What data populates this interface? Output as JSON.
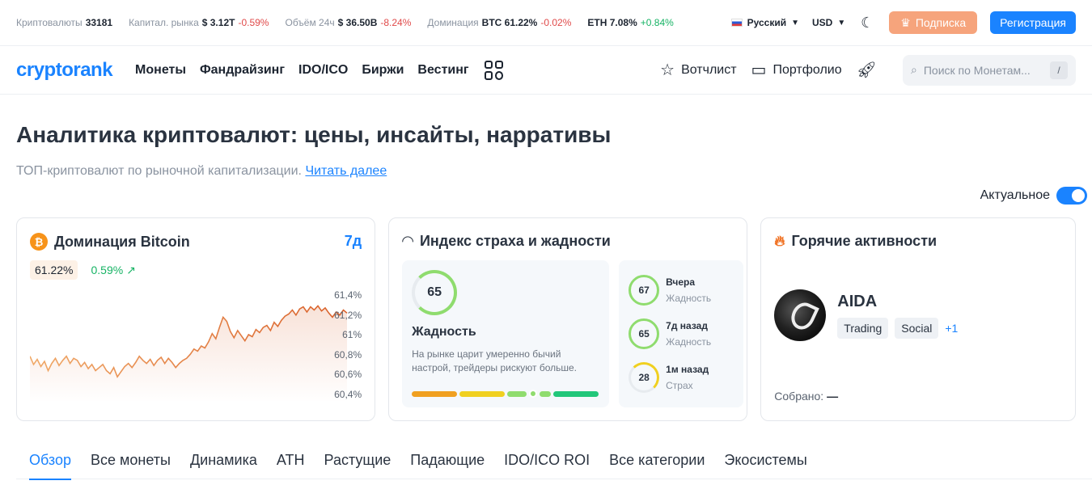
{
  "topbar": {
    "stats": [
      {
        "label": "Криптовалюты",
        "value": "33181",
        "change": ""
      },
      {
        "label": "Капитал. рынка",
        "value": "$ 3.12T",
        "change": "-0.59%"
      },
      {
        "label": "Объём 24ч",
        "value": "$ 36.50B",
        "change": "-8.24%"
      },
      {
        "label": "Доминация",
        "value": "BTC 61.22%",
        "change": "-0.02%"
      }
    ],
    "eth": {
      "value": "ETH 7.08%",
      "change": "+0.84%"
    },
    "language": "Русский",
    "currency": "USD",
    "subscribe_label": "Подписка",
    "register_label": "Регистрация"
  },
  "nav": {
    "logo": "cryptorank",
    "links": [
      "Монеты",
      "Фандрайзинг",
      "IDO/ICO",
      "Биржи",
      "Вестинг"
    ],
    "watchlist": "Вотчлист",
    "portfolio": "Портфолио",
    "search_placeholder": "Поиск по Монетам...",
    "search_shortcut": "/"
  },
  "hero": {
    "title": "Аналитика криптовалют: цены, инсайты, нарративы",
    "subtitle": "ТОП-криптовалют по рыночной капитализации.",
    "read_more": "Читать далее",
    "toggle_label": "Актуальное"
  },
  "btc_card": {
    "title": "Доминация Bitcoin",
    "range": "7д",
    "value": "61.22%",
    "change": "0.59%",
    "y_labels": [
      "61,4%",
      "61,2%",
      "61%",
      "60,8%",
      "60,6%",
      "60,4%"
    ],
    "colors": {
      "line_start": "#f0a968",
      "line_end": "#d9602a"
    }
  },
  "chart_data": {
    "type": "line",
    "title": "Доминация Bitcoin",
    "xlabel": "",
    "ylabel": "",
    "ylim": [
      60.35,
      61.45
    ],
    "y_ticks": [
      "61,4%",
      "61,2%",
      "61%",
      "60,8%",
      "60,6%",
      "60,4%"
    ],
    "series": [
      {
        "values": [
          60.8,
          60.72,
          60.77,
          60.7,
          60.75,
          60.66,
          60.73,
          60.78,
          60.71,
          60.76,
          60.8,
          60.73,
          60.78,
          60.76,
          60.7,
          60.74,
          60.68,
          60.72,
          60.66,
          60.69,
          60.72,
          60.66,
          60.63,
          60.69,
          60.6,
          60.65,
          60.7,
          60.73,
          60.69,
          60.74,
          60.8,
          60.76,
          60.73,
          60.77,
          60.71,
          60.76,
          60.79,
          60.73,
          60.78,
          60.74,
          60.69,
          60.73,
          60.76,
          60.78,
          60.82,
          60.87,
          60.85,
          60.9,
          60.88,
          60.94,
          61.02,
          60.97,
          61.08,
          61.18,
          61.14,
          61.04,
          60.98,
          61.05,
          61.0,
          60.95,
          61.01,
          60.99,
          61.06,
          61.03,
          61.08,
          61.1,
          61.05,
          61.13,
          61.09,
          61.15,
          61.19,
          61.21,
          61.25,
          61.2,
          61.26,
          61.28,
          61.23,
          61.28,
          61.25,
          61.29,
          61.24,
          61.27,
          61.22,
          61.18,
          61.23,
          61.2,
          61.25,
          61.22
        ]
      }
    ]
  },
  "fear_greed": {
    "title": "Индекс страха и жадности",
    "value": "65",
    "label": "Жадность",
    "description": "На рынке царит умеренно бычий настрой, трейдеры рискуют больше.",
    "history": [
      {
        "value": "67",
        "when": "Вчера",
        "label": "Жадность",
        "color": "#8fdc6e"
      },
      {
        "value": "65",
        "when": "7д назад",
        "label": "Жадность",
        "color": "#8fdc6e"
      },
      {
        "value": "28",
        "when": "1м назад",
        "label": "Страх",
        "color": "#f0d020"
      }
    ],
    "scale_colors": [
      "#f0a020",
      "#f0d020",
      "#8fdc6e",
      "#8fdc6e",
      "#22c77a"
    ]
  },
  "hot": {
    "title": "Горячие активности",
    "name": "AIDA",
    "tags": [
      "Trading",
      "Social"
    ],
    "more": "+1",
    "collected_label": "Собрано:",
    "collected_value": "—"
  },
  "tabs": [
    "Обзор",
    "Все монеты",
    "Динамика",
    "ATH",
    "Растущие",
    "Падающие",
    "IDO/ICO ROI",
    "Все категории",
    "Экосистемы"
  ]
}
